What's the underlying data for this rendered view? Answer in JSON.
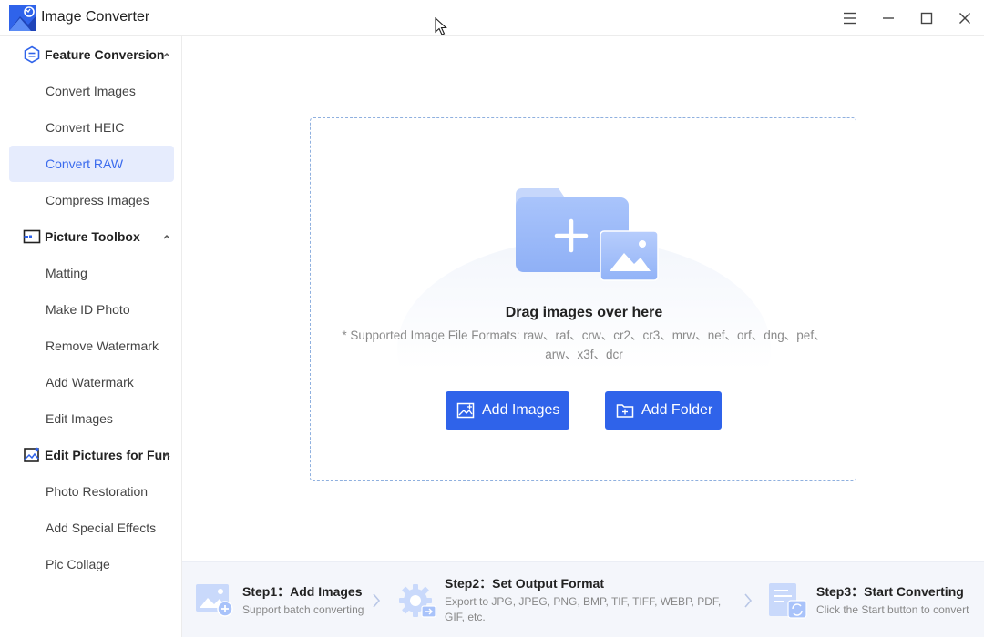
{
  "app": {
    "title": "Image Converter"
  },
  "sidebar": {
    "groups": [
      {
        "label": "Feature Conversion",
        "items": [
          "Convert Images",
          "Convert HEIC",
          "Convert RAW",
          "Compress Images"
        ]
      },
      {
        "label": "Picture Toolbox",
        "items": [
          "Matting",
          "Make ID Photo",
          "Remove Watermark",
          "Add Watermark",
          "Edit Images"
        ]
      },
      {
        "label": "Edit Pictures for Fun",
        "items": [
          "Photo Restoration",
          "Add Special Effects",
          "Pic Collage"
        ]
      }
    ],
    "active_item": "Convert RAW"
  },
  "dropzone": {
    "title": "Drag images over here",
    "formats_line1": "* Supported Image File Formats: raw、raf、crw、cr2、cr3、mrw、nef、orf、dng、pef、",
    "formats_line2": "arw、x3f、dcr",
    "add_images_label": "Add Images",
    "add_folder_label": "Add Folder"
  },
  "steps": [
    {
      "title": "Step1：Add Images",
      "desc": "Support batch converting"
    },
    {
      "title": "Step2：Set Output Format",
      "desc": "Export to JPG, JPEG, PNG, BMP, TIF, TIFF, WEBP, PDF, GIF, etc."
    },
    {
      "title": "Step3：Start Converting",
      "desc": "Click the Start button to convert"
    }
  ],
  "colors": {
    "accent": "#2f63ea",
    "active_bg": "#e6ecfd",
    "active_text": "#3b6bed",
    "dash": "#8fb0df"
  }
}
